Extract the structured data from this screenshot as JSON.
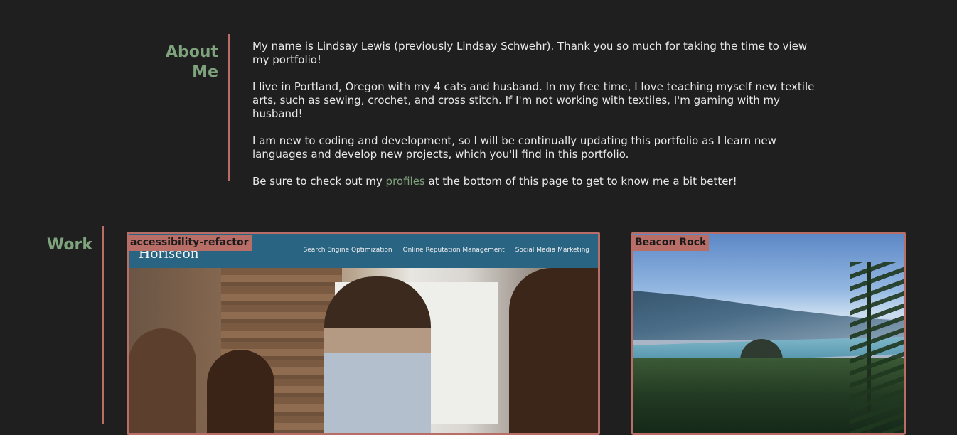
{
  "about": {
    "heading": "About Me",
    "paragraph_1": "My name is Lindsay Lewis (previously Lindsay Schwehr). Thank you so much for taking the time to view my portfolio!",
    "paragraph_2": "I live in Portland, Oregon with my 4 cats and husband. In my free time, I love teaching myself new textile arts, such as sewing, crochet, and cross stitch. If I'm not working with textiles, I'm gaming with my husband!",
    "paragraph_3": "I am new to coding and development, so I will be continually updating this portfolio as I learn new languages and develop new projects, which you'll find in this portfolio.",
    "paragraph_4_before": "Be sure to check out my ",
    "paragraph_4_link": "profiles",
    "paragraph_4_after": " at the bottom of this page to get to know me a bit better!"
  },
  "work": {
    "heading": "Work",
    "projects": [
      {
        "label": "accessibility-refactor",
        "screenshot": {
          "logo": "Horiseon",
          "nav": [
            "Search Engine Optimization",
            "Online Reputation Management",
            "Social Media Marketing"
          ]
        }
      },
      {
        "label": "Beacon Rock"
      }
    ]
  },
  "colors": {
    "background": "#1f1f1f",
    "accent_green": "#7fa37d",
    "accent_rose": "#b86d66",
    "text": "#e9e9e9"
  }
}
